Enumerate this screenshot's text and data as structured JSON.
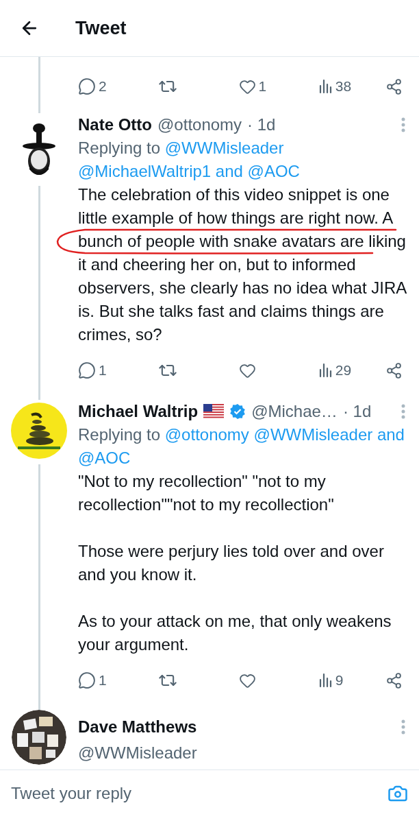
{
  "header": {
    "title": "Tweet"
  },
  "top_actions": {
    "replies": "2",
    "likes": "1",
    "views": "38"
  },
  "tweets": [
    {
      "name": "Nate Otto",
      "flag": false,
      "verified": false,
      "handle": "@ottonomy",
      "time": "· 1d",
      "replying_label": "Replying to",
      "replying_parts": [
        "@WWMisleader",
        "@MichaelWaltrip1 and",
        "@AOC"
      ],
      "paragraphs": [
        "The celebration of this video snippet is one little example of how things are right now. A bunch of people with snake avatars are liking it and cheering her on, but to informed observers, she clearly has no idea what JIRA is. But she talks fast and claims things are crimes, so?"
      ],
      "scribble": true,
      "actions": {
        "replies": "1",
        "views": "29"
      }
    },
    {
      "name": "Michael Waltrip",
      "flag": true,
      "verified": true,
      "handle": "@Michae…",
      "time": "· 1d",
      "replying_label": "Replying to",
      "replying_parts": [
        "@ottonomy",
        "@WWMisleader and",
        "@AOC"
      ],
      "paragraphs": [
        "\"Not to my recollection\" \"not to my recollection\"\"not to my recollection\"",
        "Those were perjury lies told over and over and you know it.",
        "As to your attack on me, that only weakens your argument."
      ],
      "scribble": false,
      "actions": {
        "replies": "1",
        "views": "9"
      }
    }
  ],
  "last_tweet": {
    "name": "Dave Matthews",
    "handle": "@WWMisleader"
  },
  "reply_bar": {
    "placeholder": "Tweet your reply"
  }
}
